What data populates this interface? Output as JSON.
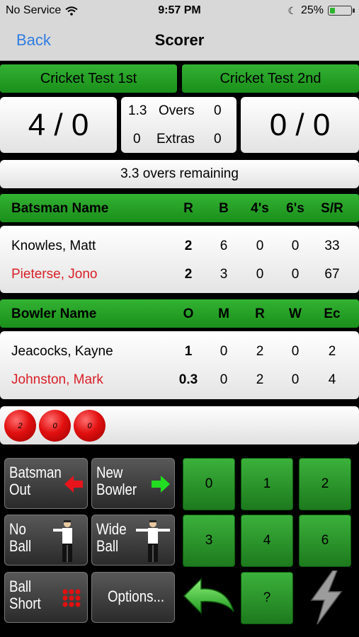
{
  "status": {
    "carrier": "No Service",
    "time": "9:57 PM",
    "battery": "25%",
    "battery_level": 0.25
  },
  "nav": {
    "back": "Back",
    "title": "Scorer"
  },
  "teams": {
    "first": "Cricket Test 1st",
    "second": "Cricket Test 2nd"
  },
  "score": {
    "first": "4 / 0",
    "second": "0 / 0",
    "overs_bowled": "1.3",
    "overs_label": "Overs",
    "overs_right": "0",
    "extras_left": "0",
    "extras_label": "Extras",
    "extras_right": "0"
  },
  "remaining": "3.3 overs remaining",
  "batting": {
    "headers": {
      "name": "Batsman Name",
      "r": "R",
      "b": "B",
      "fours": "4's",
      "sixes": "6's",
      "sr": "S/R"
    },
    "rows": [
      {
        "name": "Knowles, Matt",
        "r": "2",
        "b": "6",
        "fours": "0",
        "sixes": "0",
        "sr": "33"
      },
      {
        "name": "Pieterse, Jono",
        "r": "2",
        "b": "3",
        "fours": "0",
        "sixes": "0",
        "sr": "67"
      }
    ]
  },
  "bowling": {
    "headers": {
      "name": "Bowler Name",
      "o": "O",
      "m": "M",
      "r": "R",
      "w": "W",
      "ec": "Ec"
    },
    "rows": [
      {
        "name": "Jeacocks, Kayne",
        "o": "1",
        "m": "0",
        "r": "2",
        "w": "0",
        "ec": "2"
      },
      {
        "name": "Johnston, Mark",
        "o": "0.3",
        "m": "0",
        "r": "2",
        "w": "0",
        "ec": "4"
      }
    ]
  },
  "balls": [
    "2",
    "0",
    "0"
  ],
  "buttons": {
    "batsman_out": "Batsman\nOut",
    "new_bowler": "New\nBowler",
    "no_ball": "No\nBall",
    "wide_ball": "Wide\nBall",
    "ball_short": "Ball\nShort",
    "options": "Options..."
  },
  "runs": [
    "0",
    "1",
    "2",
    "3",
    "4",
    "6",
    "?"
  ],
  "colors": {
    "accent_green": "#1a8f1a",
    "link_blue": "#2f7de1",
    "highlight_red": "#d81f26"
  }
}
